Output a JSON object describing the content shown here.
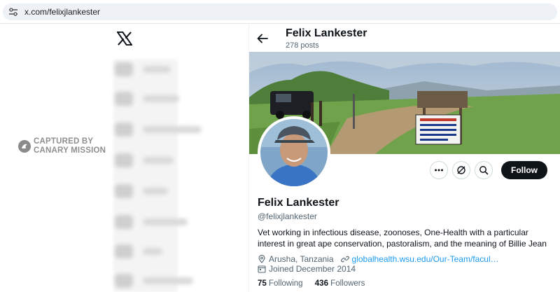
{
  "browser": {
    "url": "x.com/felixjlankester"
  },
  "captured": {
    "line1": "CAPTURED BY",
    "line2": "CANARY MISSION"
  },
  "profile": {
    "header_name": "Felix Lankester",
    "header_posts": "278 posts",
    "name": "Felix Lankester",
    "handle": "@felixjlankester",
    "bio": "Vet working in infectious disease, zoonoses, One-Health with a particular interest in great ape conservation, pastoralism, and the meaning of Billie Jean",
    "location": "Arusha, Tanzania",
    "website": "globalhealth.wsu.edu/Our-Team/facul…",
    "joined": "Joined December 2014",
    "following_count": "75",
    "following_label": "Following",
    "followers_count": "436",
    "followers_label": "Followers"
  },
  "actions": {
    "follow_label": "Follow"
  },
  "icons": {
    "back": "arrow-left-icon",
    "more": "more-icon",
    "grok": "grok-icon",
    "search": "search-icon",
    "location": "location-icon",
    "link": "link-icon",
    "calendar": "calendar-icon"
  },
  "colors": {
    "accent": "#1d9bf0",
    "text": "#0f1419",
    "muted": "#536471",
    "follow_bg": "#0f1419"
  }
}
